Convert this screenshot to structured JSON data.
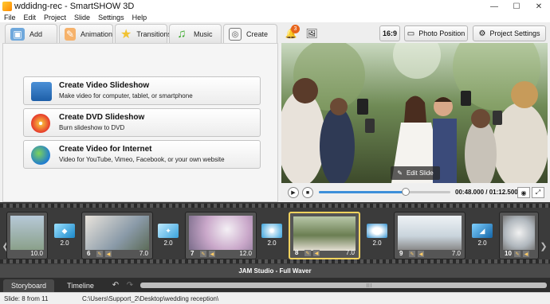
{
  "window": {
    "title": "wddidng-rec - SmartSHOW 3D",
    "minimize": "—",
    "maximize": "☐",
    "close": "✕"
  },
  "menu": [
    "File",
    "Edit",
    "Project",
    "Slide",
    "Settings",
    "Help"
  ],
  "tabs": [
    {
      "label": "Add",
      "icon": "add-photo-icon"
    },
    {
      "label": "Animation",
      "icon": "palette-icon"
    },
    {
      "label": "Transitions",
      "icon": "star-icon"
    },
    {
      "label": "Music",
      "icon": "music-note-icon"
    },
    {
      "label": "Create",
      "icon": "film-reel-icon",
      "active": true
    }
  ],
  "toolbar": {
    "notifications_count": "3",
    "aspect_ratio": "16:9",
    "photo_position": "Photo Position",
    "project_settings": "Project Settings"
  },
  "create_options": [
    {
      "title": "Create Video Slideshow",
      "desc": "Make video for computer, tablet, or smartphone",
      "icon": "video-device-icon"
    },
    {
      "title": "Create DVD Slideshow",
      "desc": "Burn slideshow to DVD",
      "icon": "dvd-icon"
    },
    {
      "title": "Create Video for Internet",
      "desc": "Video for YouTube, Vimeo, Facebook, or your own website",
      "icon": "globe-icon"
    }
  ],
  "preview": {
    "edit_slide": "Edit Slide",
    "timecode": "00:48.000 / 01:12.500",
    "progress": 0.66
  },
  "storyboard": {
    "slides": [
      {
        "num": "",
        "dur": "10.0",
        "selected": false
      },
      {
        "num": "6",
        "dur": "7.0",
        "selected": false
      },
      {
        "num": "7",
        "dur": "12.0",
        "selected": false
      },
      {
        "num": "8",
        "dur": "7.0",
        "selected": true
      },
      {
        "num": "9",
        "dur": "7.0",
        "selected": false
      },
      {
        "num": "10",
        "dur": "",
        "selected": false
      }
    ],
    "transitions": [
      "2.0",
      "2.0",
      "2.0",
      "2.0",
      "2.0",
      "2.0"
    ],
    "music": "JAM Studio - Full Waver"
  },
  "bottom_tabs": [
    "Storyboard",
    "Timeline"
  ],
  "status": {
    "slide": "Slide: 8 from 11",
    "path": "C:\\Users\\Support_2\\Desktop\\wedding reception\\"
  },
  "colors": {
    "accent": "#3d8fd9",
    "selected_slide": "#f4d35e",
    "badge": "#e8641b"
  }
}
